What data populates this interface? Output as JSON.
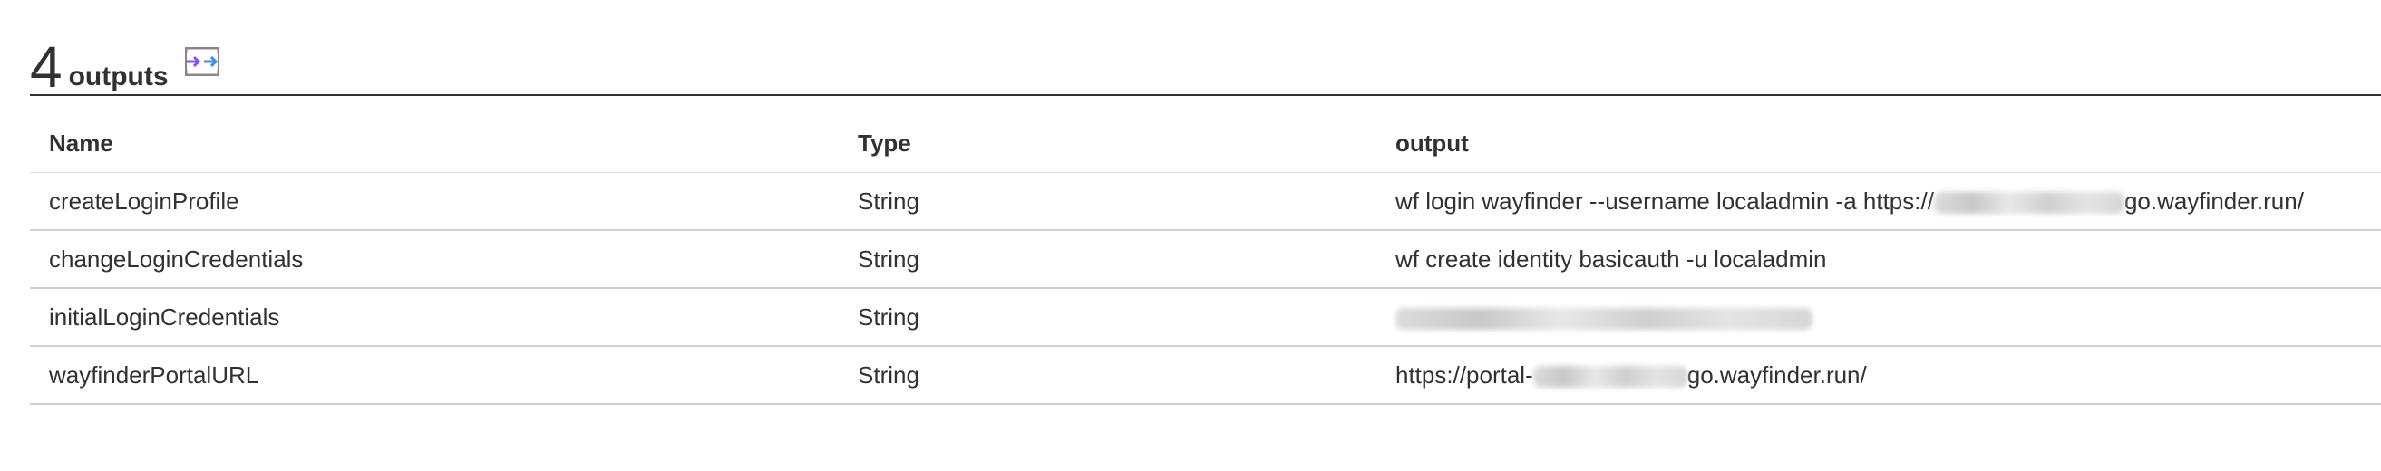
{
  "header": {
    "count": "4",
    "label": "outputs",
    "toggle_icon": "columns-toggle-icon"
  },
  "table": {
    "columns": [
      "Name",
      "Type",
      "output"
    ],
    "rows": [
      {
        "name": "createLoginProfile",
        "type": "String",
        "output_prefix": "wf login wayfinder --username localadmin -a https://",
        "output_suffix": "go.wayfinder.run/"
      },
      {
        "name": "changeLoginCredentials",
        "type": "String",
        "output_prefix": "wf create identity basicauth -u localadmin",
        "output_suffix": ""
      },
      {
        "name": "initialLoginCredentials",
        "type": "String",
        "output_prefix": "",
        "output_suffix": ""
      },
      {
        "name": "wayfinderPortalURL",
        "type": "String",
        "output_prefix": "https://portal-",
        "output_suffix": "go.wayfinder.run/"
      }
    ]
  },
  "colors": {
    "text": "#323130",
    "header_rule": "#323130",
    "row_border": "#d2d0ce",
    "icon_purple": "#8a4fff",
    "icon_blue": "#3b8eea"
  }
}
